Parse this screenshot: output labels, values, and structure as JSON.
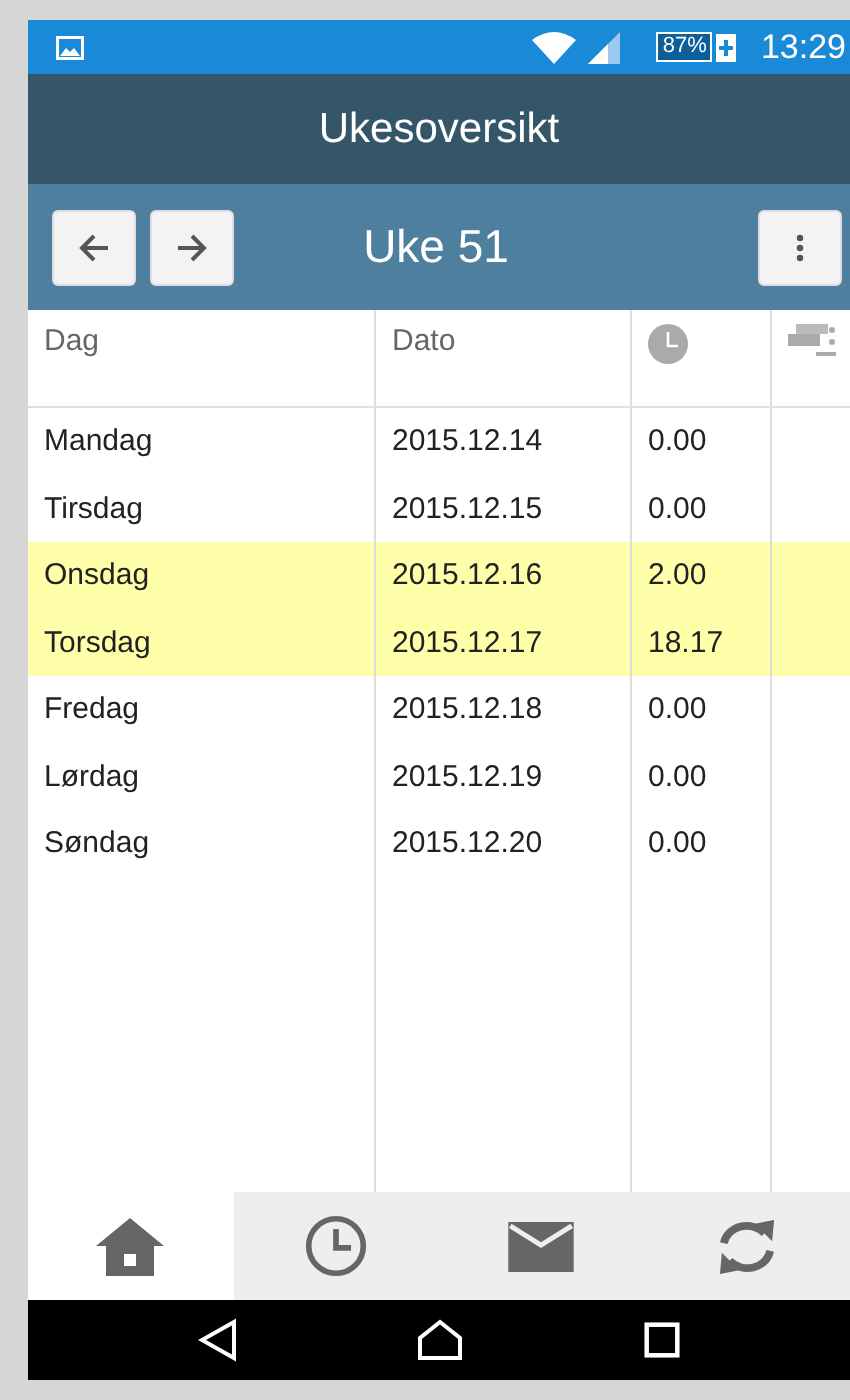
{
  "status_bar": {
    "battery": "87%",
    "time": "13:29"
  },
  "title": "Ukesoversikt",
  "toolbar": {
    "week": "Uke 51"
  },
  "table": {
    "columns": [
      "Dag",
      "Dato"
    ],
    "rows": [
      {
        "day": "Mandag",
        "date": "2015.12.14",
        "hours": "0.00",
        "highlighted": false
      },
      {
        "day": "Tirsdag",
        "date": "2015.12.15",
        "hours": "0.00",
        "highlighted": false
      },
      {
        "day": "Onsdag",
        "date": "2015.12.16",
        "hours": "2.00",
        "highlighted": true
      },
      {
        "day": "Torsdag",
        "date": "2015.12.17",
        "hours": "18.17",
        "highlighted": true
      },
      {
        "day": "Fredag",
        "date": "2015.12.18",
        "hours": "0.00",
        "highlighted": false
      },
      {
        "day": "Lørdag",
        "date": "2015.12.19",
        "hours": "0.00",
        "highlighted": false
      },
      {
        "day": "Søndag",
        "date": "2015.12.20",
        "hours": "0.00",
        "highlighted": false
      }
    ]
  },
  "tabs": [
    {
      "kind": "home",
      "selected": true
    },
    {
      "kind": "clock",
      "selected": false
    },
    {
      "kind": "mail",
      "selected": false
    },
    {
      "kind": "sync",
      "selected": false
    }
  ]
}
